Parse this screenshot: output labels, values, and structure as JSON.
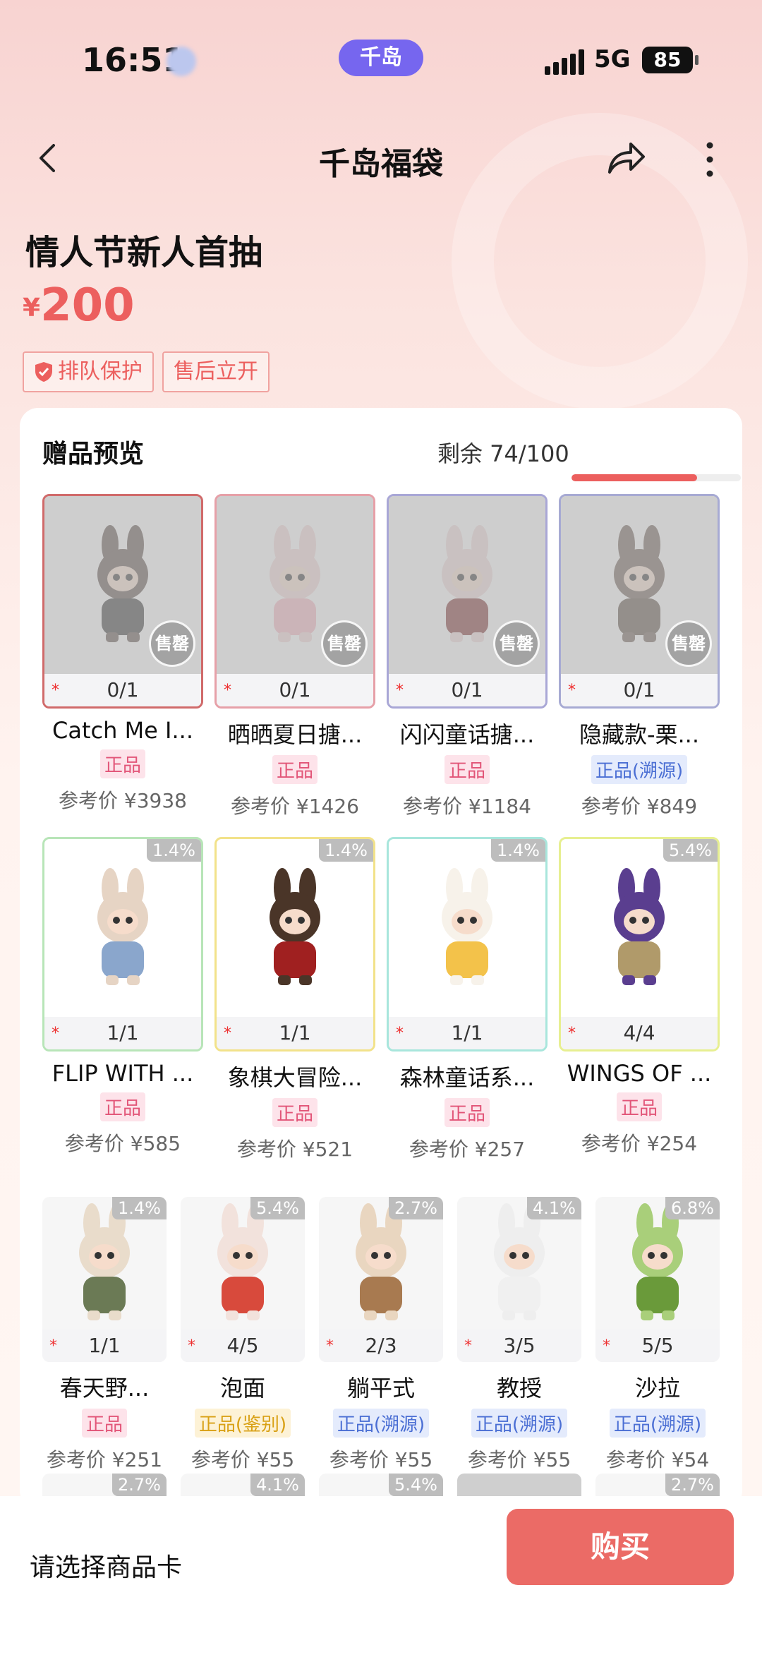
{
  "status_bar": {
    "time": "16:51",
    "app_pill": "千岛",
    "network": "5G",
    "battery": "85"
  },
  "nav": {
    "title": "千岛福袋"
  },
  "product": {
    "title": "情人节新人首抽",
    "currency": "¥",
    "price": "200",
    "tags": [
      "排队保护",
      "售后立开"
    ]
  },
  "preview": {
    "title": "赠品预览",
    "remaining_text": "剩余 74/100",
    "remaining_fraction": 0.74,
    "sold_label": "售罄"
  },
  "row1": [
    {
      "name": "Catch Me I...",
      "count": "0/1",
      "auth": "正品",
      "ref": "参考价 ¥3938",
      "border": "#d06a6a"
    },
    {
      "name": "晒晒夏日搪...",
      "count": "0/1",
      "auth": "正品",
      "ref": "参考价 ¥1426",
      "border": "#e6a0a8"
    },
    {
      "name": "闪闪童话搪...",
      "count": "0/1",
      "auth": "正品",
      "ref": "参考价 ¥1184",
      "border": "#a9a7d6"
    },
    {
      "name": "隐藏款-栗...",
      "count": "0/1",
      "auth": "正品(溯源)",
      "ref": "参考价 ¥849",
      "border": "#a7aad3"
    }
  ],
  "row2": [
    {
      "name": "FLIP WITH ...",
      "count": "1/1",
      "pct": "1.4%",
      "auth": "正品",
      "ref": "参考价 ¥585",
      "border": "#b8e5b8"
    },
    {
      "name": "象棋大冒险...",
      "count": "1/1",
      "pct": "1.4%",
      "auth": "正品",
      "ref": "参考价 ¥521",
      "border": "#f2e28a"
    },
    {
      "name": "森林童话系...",
      "count": "1/1",
      "pct": "1.4%",
      "auth": "正品",
      "ref": "参考价 ¥257",
      "border": "#a8e6dc"
    },
    {
      "name": "WINGS OF ...",
      "count": "4/4",
      "pct": "5.4%",
      "auth": "正品",
      "ref": "参考价 ¥254",
      "border": "#e7ef91"
    }
  ],
  "row3": [
    {
      "name": "春天野...",
      "count": "1/1",
      "pct": "1.4%",
      "auth": "正品",
      "ref": "参考价 ¥251"
    },
    {
      "name": "泡面",
      "count": "4/5",
      "pct": "5.4%",
      "auth": "正品(鉴别)",
      "ref": "参考价 ¥55"
    },
    {
      "name": "躺平式",
      "count": "2/3",
      "pct": "2.7%",
      "auth": "正品(溯源)",
      "ref": "参考价 ¥55"
    },
    {
      "name": "教授",
      "count": "3/5",
      "pct": "4.1%",
      "auth": "正品(溯源)",
      "ref": "参考价 ¥55"
    },
    {
      "name": "沙拉",
      "count": "5/5",
      "pct": "6.8%",
      "auth": "正品(溯源)",
      "ref": "参考价 ¥54"
    }
  ],
  "row4": [
    {
      "pct": "2.7%"
    },
    {
      "pct": "4.1%"
    },
    {
      "pct": "5.4%"
    },
    {
      "pct": ""
    },
    {
      "pct": "2.7%"
    }
  ],
  "bottom": {
    "choose_label": "请选择商品卡",
    "buy_label": "购买"
  }
}
